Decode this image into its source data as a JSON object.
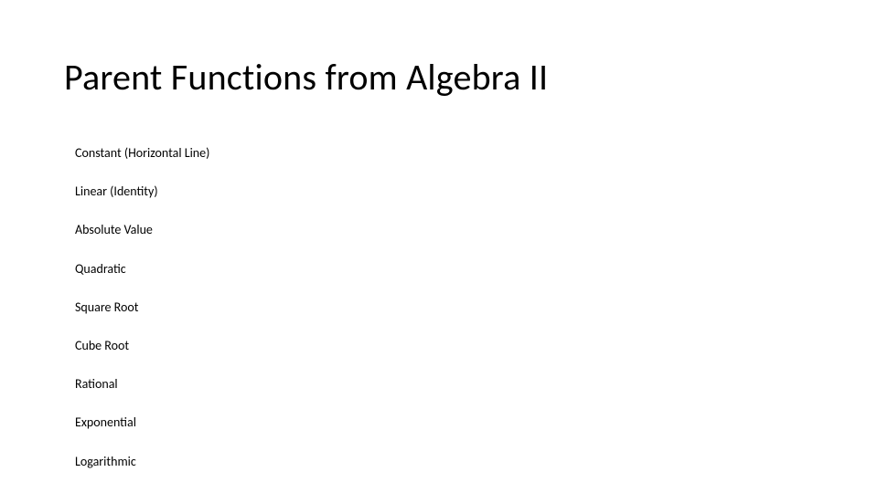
{
  "title": "Parent Functions from Algebra II",
  "items": [
    "Constant (Horizontal Line)",
    "Linear (Identity)",
    "Absolute Value",
    "Quadratic",
    "Square Root",
    "Cube Root",
    "Rational",
    "Exponential",
    "Logarithmic"
  ]
}
